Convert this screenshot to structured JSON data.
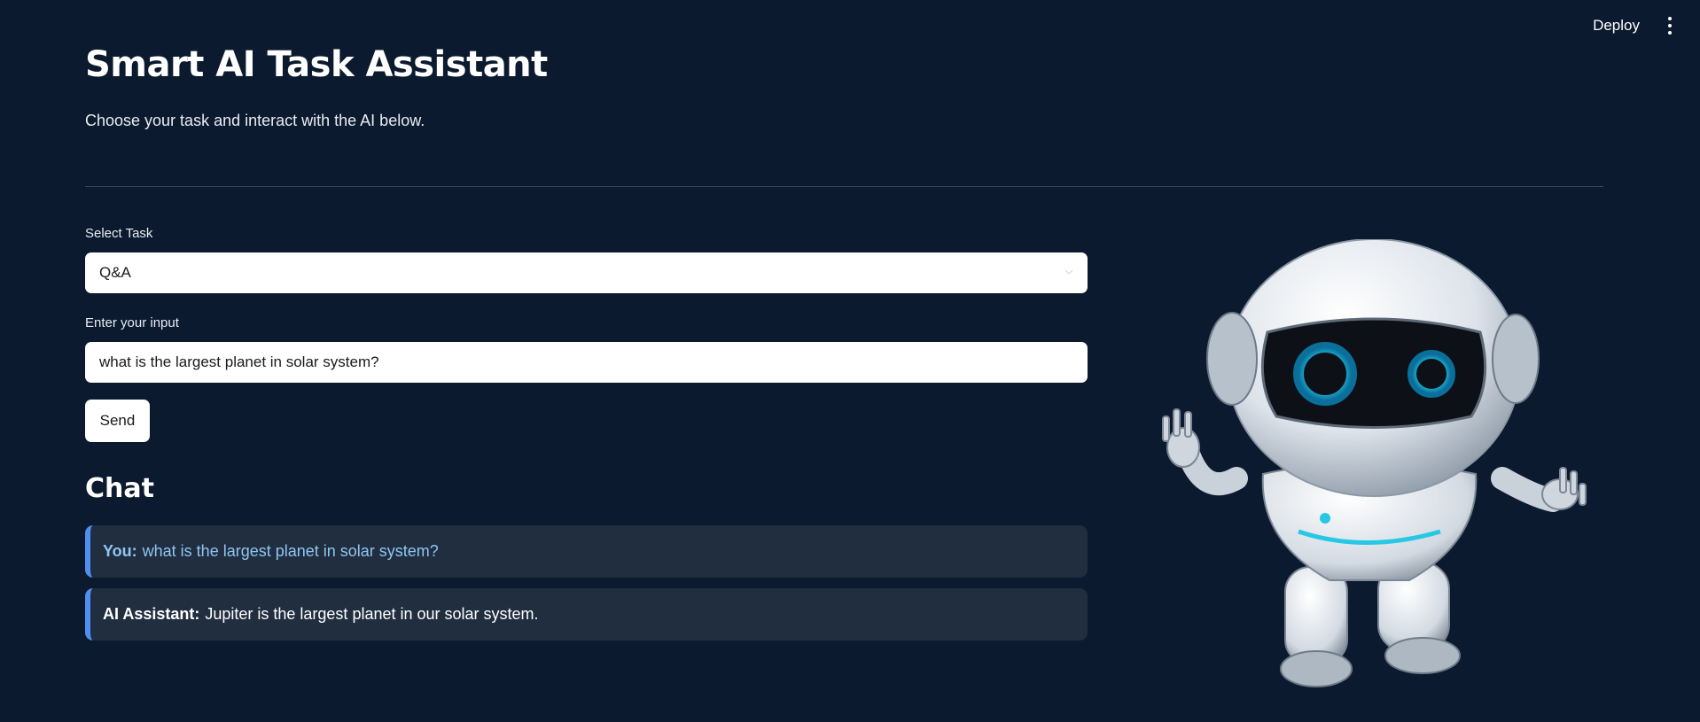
{
  "header": {
    "deploy_label": "Deploy",
    "menu_icon": "kebab-menu-icon"
  },
  "page": {
    "title": "Smart AI Task Assistant",
    "subtitle": "Choose your task and interact with the AI below."
  },
  "form": {
    "task_label": "Select Task",
    "task_value": "Q&A",
    "input_label": "Enter your input",
    "input_value": "what is the largest planet in solar system?",
    "send_label": "Send"
  },
  "chat": {
    "heading": "Chat",
    "messages": [
      {
        "speaker": "You:",
        "text": "what is the largest planet in solar system?"
      },
      {
        "speaker": "AI Assistant:",
        "text": "Jupiter is the largest planet in our solar system."
      }
    ]
  },
  "colors": {
    "background": "#0b1a2e",
    "chat_bubble": "#212e40",
    "accent": "#4f8ff0",
    "user_text": "#8fc6f2"
  },
  "illustration": {
    "icon": "robot-illustration"
  }
}
